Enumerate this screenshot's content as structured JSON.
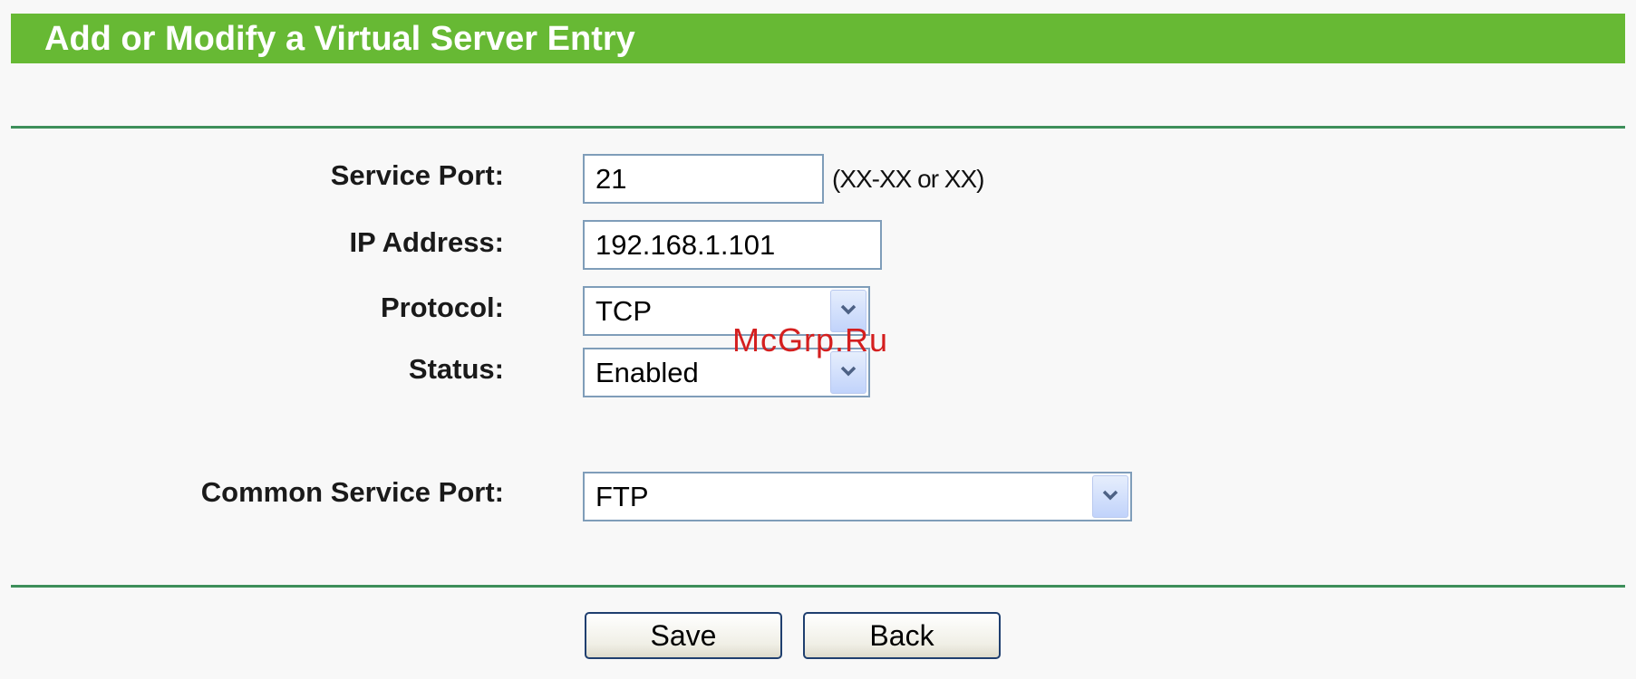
{
  "header": {
    "title": "Add or Modify a Virtual Server Entry",
    "background_color": "#67b934"
  },
  "form": {
    "service_port": {
      "label": "Service Port:",
      "value": "21",
      "hint": "(XX-XX or XX)"
    },
    "ip_address": {
      "label": "IP Address:",
      "value": "192.168.1.101"
    },
    "protocol": {
      "label": "Protocol:",
      "value": "TCP"
    },
    "status": {
      "label": "Status:",
      "value": "Enabled"
    },
    "common_service_port": {
      "label": "Common Service Port:",
      "value": "FTP"
    }
  },
  "buttons": {
    "save_label": "Save",
    "back_label": "Back"
  },
  "watermark": "McGrp.Ru",
  "divider_color": "#3d8f5a"
}
